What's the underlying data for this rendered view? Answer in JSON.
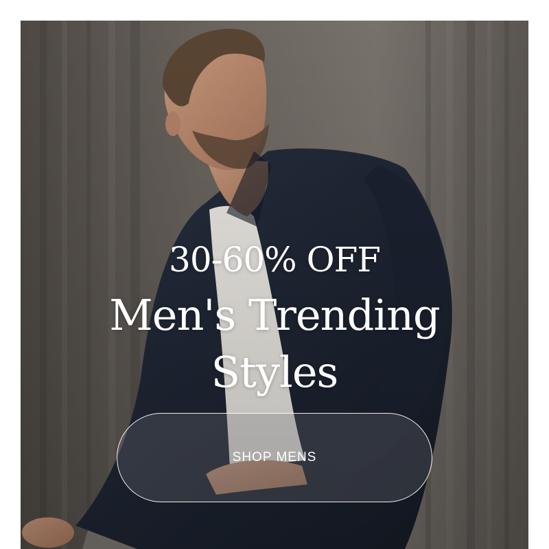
{
  "hero": {
    "discount": "30-60% OFF",
    "title_line_1": "Men's Trending",
    "title_line_2": "Styles",
    "image_subject": "man-in-navy-shirt-jacket-photo"
  },
  "cta": {
    "label": "SHOP MENS"
  },
  "colors": {
    "background": "#ffffff",
    "wall": "#6b655f",
    "jacket": "#1f2634",
    "tee": "#ece9e4",
    "pants": "#7d7872",
    "skin": "#c08f72",
    "text": "#ffffff"
  }
}
